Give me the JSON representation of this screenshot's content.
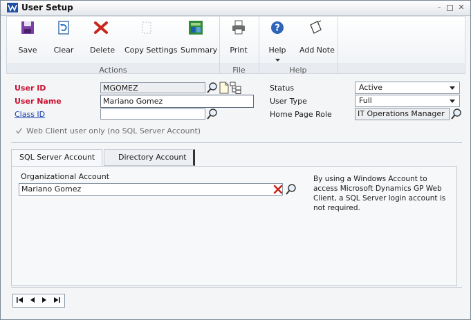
{
  "window": {
    "title": "User Setup",
    "controls": [
      "minimize-icon",
      "restore-icon",
      "close-icon"
    ]
  },
  "ribbon": {
    "buttons": [
      {
        "label": "Save",
        "icon": "save-icon"
      },
      {
        "label": "Clear",
        "icon": "clear-icon"
      },
      {
        "label": "Delete",
        "icon": "delete-icon"
      },
      {
        "label": "Copy Settings",
        "icon": "copy-settings-icon"
      },
      {
        "label": "Summary",
        "icon": "summary-icon"
      },
      {
        "label": "Print",
        "icon": "print-icon"
      },
      {
        "label": "Help",
        "icon": "help-icon"
      },
      {
        "label": "Add Note",
        "icon": "note-icon"
      }
    ],
    "groups": [
      "Actions",
      "File",
      "Help"
    ]
  },
  "form": {
    "user_id_label": "User ID",
    "user_id_value": "MGOMEZ",
    "user_name_label": "User Name",
    "user_name_value": "Mariano Gomez",
    "class_id_label": "Class ID",
    "class_id_value": "",
    "status_label": "Status",
    "status_value": "Active",
    "user_type_label": "User Type",
    "user_type_value": "Full",
    "home_page_role_label": "Home Page Role",
    "home_page_role_value": "IT Operations Manager",
    "web_client_checkbox_label": "Web Client user only (no SQL Server Account)",
    "web_client_checked": true
  },
  "tabs": {
    "sql": "SQL Server Account",
    "directory": "Directory Account",
    "active": "sql"
  },
  "panel": {
    "org_account_label": "Organizational Account",
    "org_account_value": "Mariano Gomez",
    "info_text": "By using a Windows Account to access Microsoft Dynamics GP Web Client, a SQL Server login account is not required."
  },
  "colors": {
    "required_label": "#c8102e",
    "link": "#1a3fae"
  }
}
